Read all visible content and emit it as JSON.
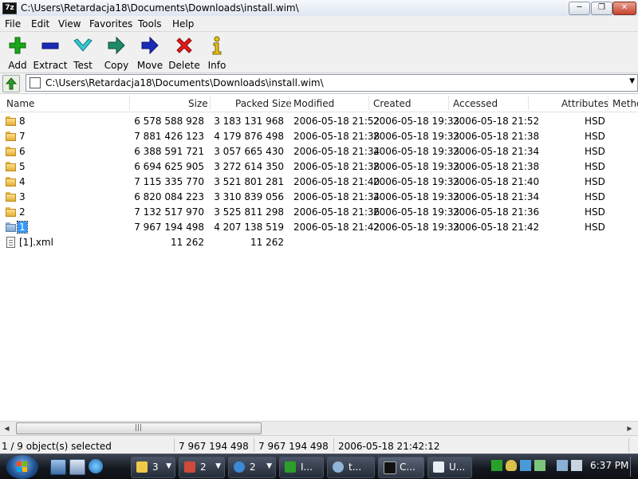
{
  "window": {
    "app_icon_text": "7z",
    "title": "C:\\Users\\Retardacja18\\Documents\\Downloads\\install.wim\\",
    "minimize_glyph": "─",
    "maximize_glyph": "❐",
    "close_glyph": "✕"
  },
  "menu": [
    "File",
    "Edit",
    "View",
    "Favorites",
    "Tools",
    "Help"
  ],
  "toolbar": {
    "add": "Add",
    "extract": "Extract",
    "test": "Test",
    "copy": "Copy",
    "move": "Move",
    "delete": "Delete",
    "info": "Info"
  },
  "address": {
    "path": "C:\\Users\\Retardacja18\\Documents\\Downloads\\install.wim\\",
    "dropdown_glyph": "▼"
  },
  "columns": {
    "name": "Name",
    "size": "Size",
    "packed": "Packed Size",
    "modified": "Modified",
    "created": "Created",
    "accessed": "Accessed",
    "attributes": "Attributes",
    "method": "Metho"
  },
  "rows": [
    {
      "name": "8",
      "size": "6 578 588 928",
      "packed": "3 183 131 968",
      "modified": "2006-05-18 21:52",
      "created": "2006-05-18 19:33",
      "accessed": "2006-05-18 21:52",
      "attributes": "HSD"
    },
    {
      "name": "7",
      "size": "7 881 426 123",
      "packed": "4 179 876 498",
      "modified": "2006-05-18 21:38",
      "created": "2006-05-18 19:33",
      "accessed": "2006-05-18 21:38",
      "attributes": "HSD"
    },
    {
      "name": "6",
      "size": "6 388 591 721",
      "packed": "3 057 665 430",
      "modified": "2006-05-18 21:34",
      "created": "2006-05-18 19:33",
      "accessed": "2006-05-18 21:34",
      "attributes": "HSD"
    },
    {
      "name": "5",
      "size": "6 694 625 905",
      "packed": "3 272 614 350",
      "modified": "2006-05-18 21:38",
      "created": "2006-05-18 19:33",
      "accessed": "2006-05-18 21:38",
      "attributes": "HSD"
    },
    {
      "name": "4",
      "size": "7 115 335 770",
      "packed": "3 521 801 281",
      "modified": "2006-05-18 21:40",
      "created": "2006-05-18 19:33",
      "accessed": "2006-05-18 21:40",
      "attributes": "HSD"
    },
    {
      "name": "3",
      "size": "6 820 084 223",
      "packed": "3 310 839 056",
      "modified": "2006-05-18 21:34",
      "created": "2006-05-18 19:33",
      "accessed": "2006-05-18 21:34",
      "attributes": "HSD"
    },
    {
      "name": "2",
      "size": "7 132 517 970",
      "packed": "3 525 811 298",
      "modified": "2006-05-18 21:36",
      "created": "2006-05-18 19:33",
      "accessed": "2006-05-18 21:36",
      "attributes": "HSD"
    },
    {
      "name": "1",
      "size": "7 967 194 498",
      "packed": "4 207 138 519",
      "modified": "2006-05-18 21:42",
      "created": "2006-05-18 19:33",
      "accessed": "2006-05-18 21:42",
      "attributes": "HSD"
    },
    {
      "name": "[1].xml",
      "size": "11 262",
      "packed": "11 262",
      "modified": "",
      "created": "",
      "accessed": "",
      "attributes": ""
    }
  ],
  "scrollbar": {
    "left_glyph": "◀",
    "right_glyph": "▶",
    "grip": "|||"
  },
  "status": {
    "selection": "1 / 9 object(s) selected",
    "size": "7 967 194 498",
    "packed": "7 967 194 498",
    "modified": "2006-05-18 21:42:12"
  },
  "taskbar": {
    "tasks": [
      {
        "label": "3",
        "arrow": "▼"
      },
      {
        "label": "2",
        "arrow": "▼"
      },
      {
        "label": "2",
        "arrow": "▼"
      },
      {
        "label": "I...",
        "arrow": ""
      },
      {
        "label": "t...",
        "arrow": ""
      },
      {
        "label": "C...",
        "arrow": ""
      },
      {
        "label": "U...",
        "arrow": ""
      }
    ],
    "clock": "6:37 PM"
  },
  "colors": {
    "selection": "#3399ff",
    "folder": "#f2c84b",
    "accent_green": "#1aa61a"
  }
}
